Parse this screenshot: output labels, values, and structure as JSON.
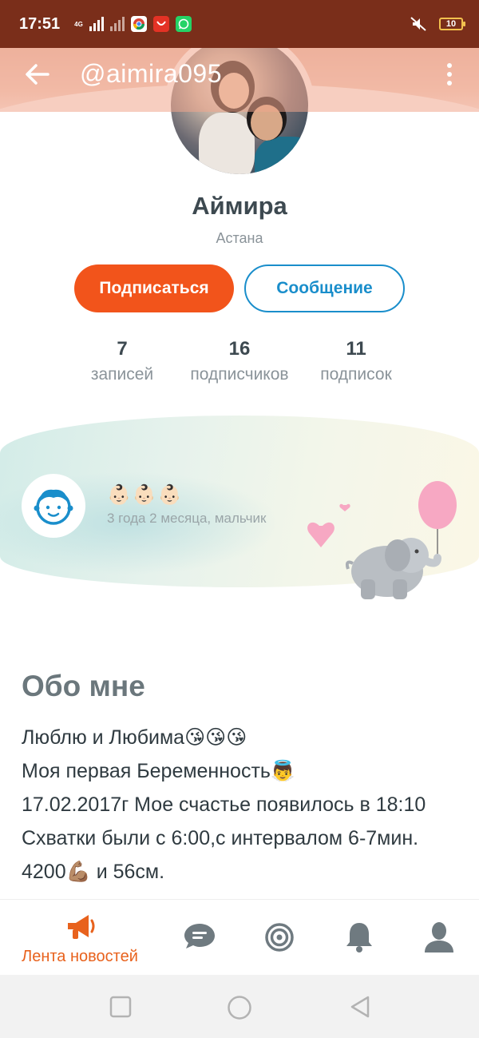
{
  "status_bar": {
    "time": "17:51",
    "network": "4G",
    "battery": "10",
    "icons": [
      "signal-icon",
      "signal-x-icon",
      "chrome-icon",
      "aliexpress-icon",
      "whatsapp-icon",
      "mute-icon",
      "battery-icon"
    ]
  },
  "app_bar": {
    "title": "@aimira095"
  },
  "profile": {
    "name": "Аймира",
    "city": "Астана",
    "subscribe_label": "Подписаться",
    "message_label": "Сообщение",
    "stats": [
      {
        "value": "7",
        "label": "записей"
      },
      {
        "value": "16",
        "label": "подписчиков"
      },
      {
        "value": "11",
        "label": "подписок"
      }
    ]
  },
  "child": {
    "emojis": "👶🏻👶🏻👶🏻",
    "age": "3 года 2 месяца, мальчик"
  },
  "about": {
    "title": "Обо мне",
    "lines": [
      "Люблю и Любима😘😘😘",
      "Моя первая Беременность👼",
      "17.02.2017г Мое счастье появилось в 18:10",
      "Схватки были с 6:00,с интервалом 6-7мин.",
      "4200💪🏽 и 56см."
    ]
  },
  "bottom_nav": {
    "items": [
      {
        "icon": "megaphone-icon",
        "label": "Лента новостей",
        "active": true
      },
      {
        "icon": "chat-icon",
        "label": ""
      },
      {
        "icon": "target-icon",
        "label": ""
      },
      {
        "icon": "bell-icon",
        "label": ""
      },
      {
        "icon": "person-icon",
        "label": ""
      }
    ]
  },
  "colors": {
    "accent": "#f2541b",
    "secondary": "#1a8ecb",
    "nav_inactive": "#6f7a80"
  }
}
